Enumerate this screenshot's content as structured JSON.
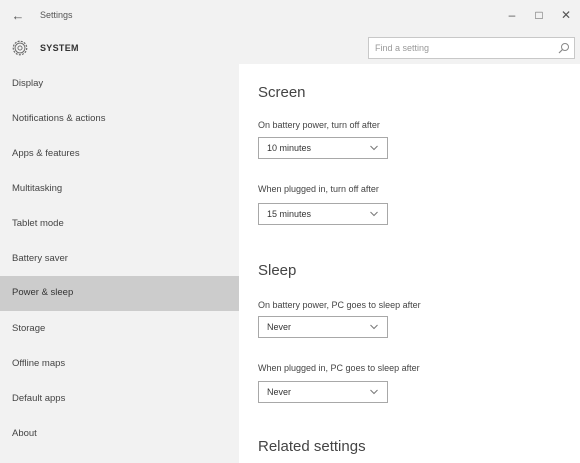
{
  "window": {
    "title": "Settings",
    "back_glyph": "←",
    "min_glyph": "–",
    "max_glyph": "□",
    "close_glyph": "✕"
  },
  "header": {
    "section": "SYSTEM",
    "search_placeholder": "Find a setting"
  },
  "sidebar": {
    "items": [
      {
        "label": "Display"
      },
      {
        "label": "Notifications & actions"
      },
      {
        "label": "Apps & features"
      },
      {
        "label": "Multitasking"
      },
      {
        "label": "Tablet mode"
      },
      {
        "label": "Battery saver"
      },
      {
        "label": "Power & sleep"
      },
      {
        "label": "Storage"
      },
      {
        "label": "Offline maps"
      },
      {
        "label": "Default apps"
      },
      {
        "label": "About"
      }
    ],
    "active_index": 6
  },
  "main": {
    "screen": {
      "heading": "Screen",
      "battery_label": "On battery power, turn off after",
      "battery_value": "10 minutes",
      "plugged_label": "When plugged in, turn off after",
      "plugged_value": "15 minutes"
    },
    "sleep": {
      "heading": "Sleep",
      "battery_label": "On battery power, PC goes to sleep after",
      "battery_value": "Never",
      "plugged_label": "When plugged in, PC goes to sleep after",
      "plugged_value": "Never"
    },
    "related": {
      "heading": "Related settings"
    }
  },
  "colors": {
    "sidebar_bg": "#f2f2f2",
    "active_item_bg": "#cccccc",
    "content_bg": "#ffffff"
  }
}
